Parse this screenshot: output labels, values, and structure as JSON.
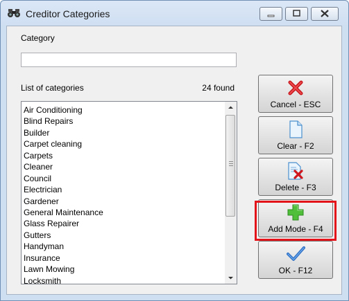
{
  "window": {
    "title": "Creditor Categories",
    "icon": "binoculars-icon",
    "controls": {
      "minimize": "minimize-icon",
      "maximize": "maximize-icon",
      "close": "close-icon"
    }
  },
  "category": {
    "label": "Category",
    "value": "",
    "placeholder": ""
  },
  "list": {
    "label": "List of categories",
    "count": "24 found",
    "items": [
      "Air Conditioning",
      "Blind Repairs",
      "Builder",
      "Carpet cleaning",
      "Carpets",
      "Cleaner",
      "Council",
      "Electrician",
      "Gardener",
      "General Maintenance",
      "Glass Repairer",
      "Gutters",
      "Handyman",
      "Insurance",
      "Lawn Mowing",
      "Locksmith"
    ]
  },
  "buttons": {
    "cancel": {
      "label": "Cancel - ESC",
      "icon": "red-x-icon"
    },
    "clear": {
      "label": "Clear - F2",
      "icon": "blank-document-icon"
    },
    "delete": {
      "label": "Delete - F3",
      "icon": "document-delete-icon"
    },
    "add": {
      "label": "Add Mode - F4",
      "icon": "green-plus-icon",
      "highlight_color": "#e3141a"
    },
    "ok": {
      "label": "OK - F12",
      "icon": "blue-checkmark-icon"
    }
  }
}
